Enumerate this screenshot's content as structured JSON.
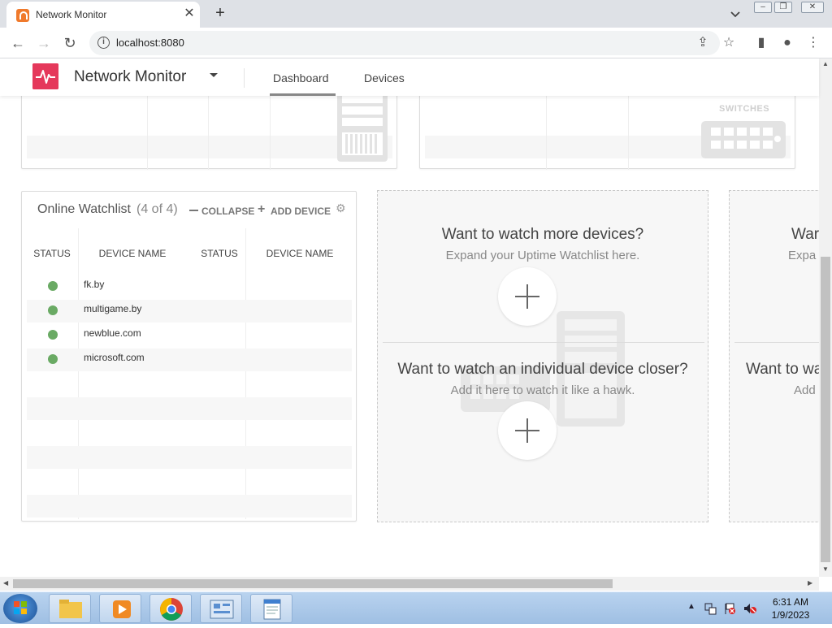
{
  "browser": {
    "tab_title": "Network Monitor",
    "tab_close": "✕",
    "new_tab": "+",
    "url": "localhost:8080"
  },
  "app": {
    "title": "Network Monitor",
    "nav": [
      "Dashboard",
      "Devices"
    ],
    "accent": "#e5385b"
  },
  "switches_card": {
    "label": "SWITCHES"
  },
  "watchlist": {
    "title": "Online Watchlist",
    "count": "(4 of 4)",
    "collapse": "COLLAPSE",
    "add_device": "ADD DEVICE",
    "columns": [
      "STATUS",
      "DEVICE NAME",
      "STATUS",
      "DEVICE NAME"
    ],
    "devices": [
      {
        "name": "fk.by",
        "status": "online"
      },
      {
        "name": "multigame.by",
        "status": "online"
      },
      {
        "name": "newblue.com",
        "status": "online"
      },
      {
        "name": "microsoft.com",
        "status": "online"
      }
    ],
    "status_color": "#6aaa64"
  },
  "promo": {
    "watch_more_title": "Want to watch more devices?",
    "watch_more_sub": "Expand your Uptime Watchlist here.",
    "watch_closer_title": "Want to watch an individual device closer?",
    "watch_closer_sub": "Add it here to watch it like a hawk.",
    "right_title_partial": "War",
    "right_sub_partial": "Expa",
    "right_title2_partial": "Want to wa",
    "right_sub2_partial": "Add"
  },
  "taskbar": {
    "time": "6:31 AM",
    "date": "1/9/2023"
  }
}
